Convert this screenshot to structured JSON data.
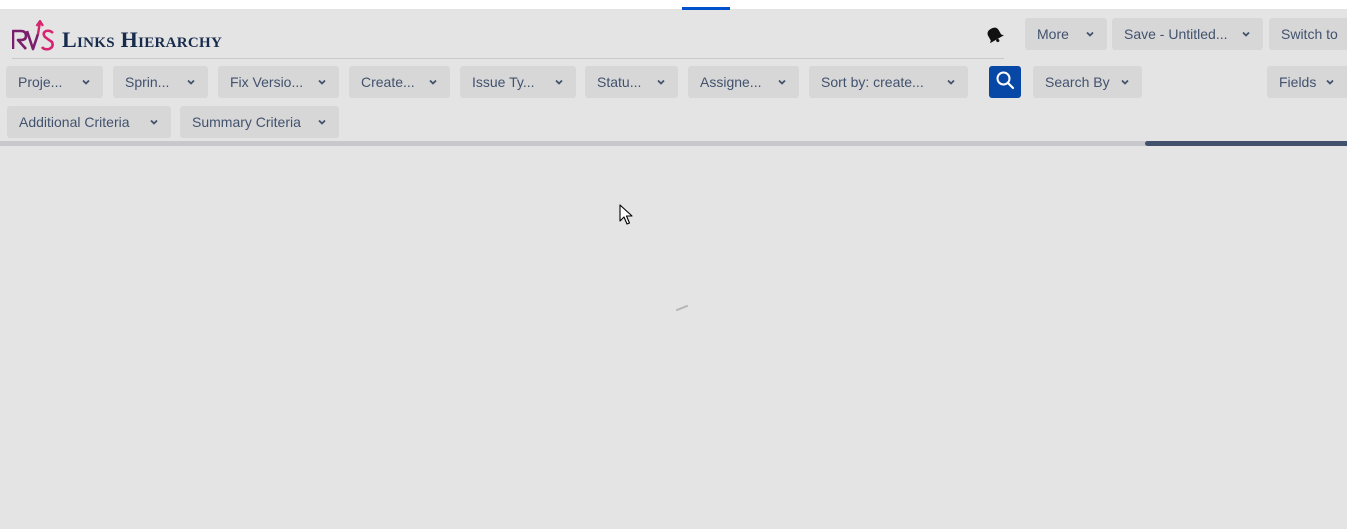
{
  "app": {
    "logo_text": "RVS",
    "title": "Links Hierarchy"
  },
  "header": {
    "more_label": "More",
    "save_label": "Save - Untitled...",
    "switch_label": "Switch to"
  },
  "filters": {
    "row1": [
      "Proje...",
      "Sprin...",
      "Fix Versio...",
      "Create...",
      "Issue Ty...",
      "Statu...",
      "Assigne...",
      "Sort by: create..."
    ],
    "search_by_label": "Search By",
    "fields_label": "Fields",
    "row2": [
      "Additional Criteria",
      "Summary Criteria"
    ]
  },
  "progress": {
    "fraction_loaded": 0.15
  },
  "colors": {
    "accent": "#0052cc",
    "search_button": "#0747a6",
    "logo_primary": "#7a1f6b",
    "logo_secondary": "#d6246e",
    "background": "#e4e4e4"
  },
  "icons": [
    "bell-icon",
    "search-icon",
    "chevron-down-icon",
    "cursor-icon",
    "loading-spinner-icon"
  ]
}
